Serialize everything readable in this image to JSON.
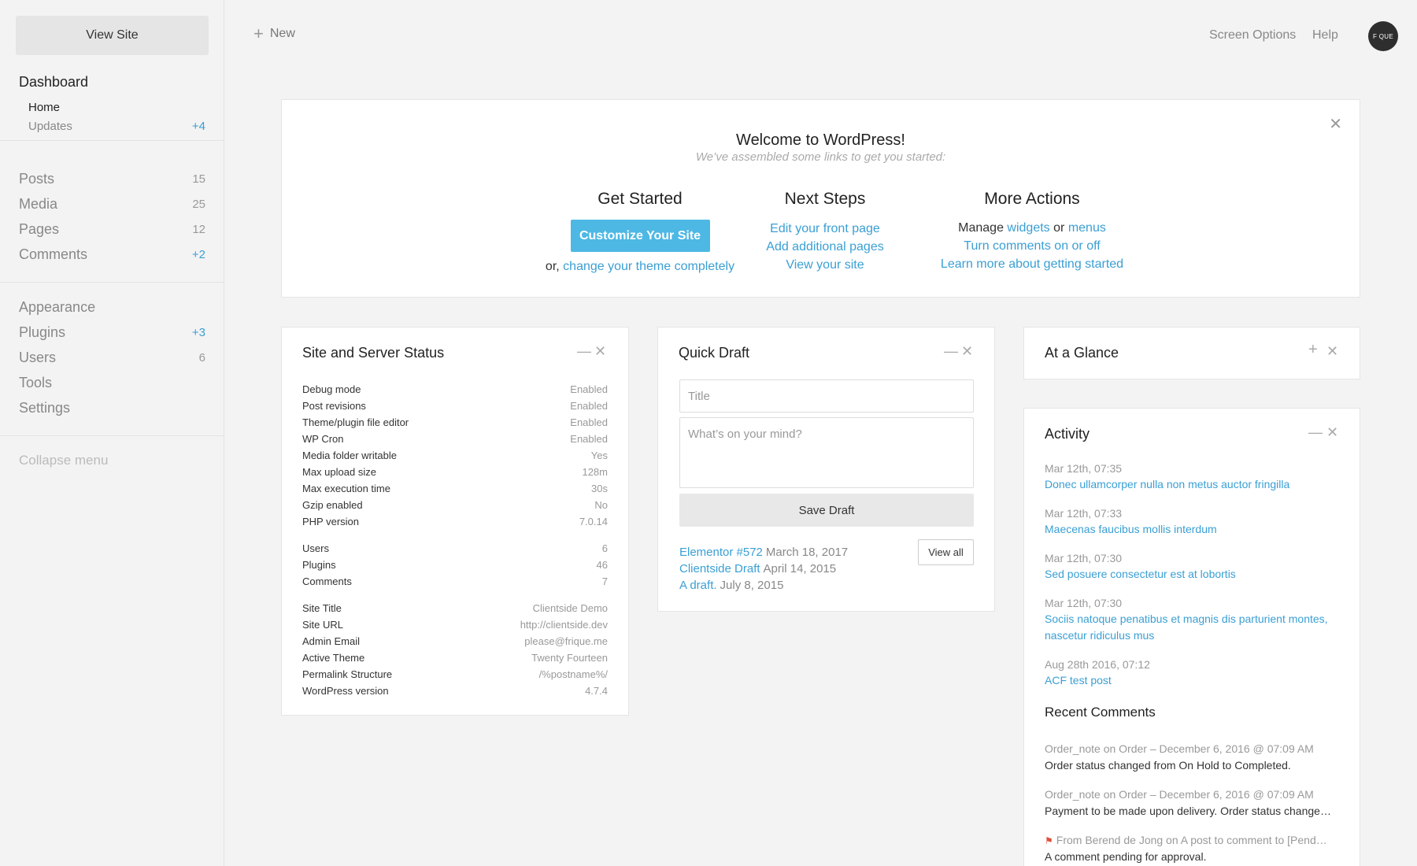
{
  "sidebar": {
    "view_site": "View Site",
    "dashboard": "Dashboard",
    "home": "Home",
    "updates": {
      "label": "Updates",
      "count": "+4"
    },
    "group1": [
      {
        "label": "Posts",
        "count": "15"
      },
      {
        "label": "Media",
        "count": "25"
      },
      {
        "label": "Pages",
        "count": "12"
      },
      {
        "label": "Comments",
        "count": "+2"
      }
    ],
    "group2": [
      {
        "label": "Appearance",
        "count": ""
      },
      {
        "label": "Plugins",
        "count": "+3"
      },
      {
        "label": "Users",
        "count": "6"
      },
      {
        "label": "Tools",
        "count": ""
      },
      {
        "label": "Settings",
        "count": ""
      }
    ],
    "collapse": "Collapse menu"
  },
  "topbar": {
    "new_label": "New",
    "screen_options": "Screen Options",
    "help": "Help",
    "avatar_text": "F QUE"
  },
  "welcome": {
    "title": "Welcome to WordPress!",
    "subtitle": "We’ve assembled some links to get you started:",
    "get_started": {
      "heading": "Get Started",
      "button": "Customize Your Site",
      "or_text": "or,",
      "change_theme": "change your theme completely"
    },
    "next_steps": {
      "heading": "Next Steps",
      "links": [
        "Edit your front page",
        "Add additional pages",
        "View your site"
      ]
    },
    "more_actions": {
      "heading": "More Actions",
      "manage": "Manage",
      "widgets": "widgets",
      "or": "or",
      "menus": "menus",
      "comments": "Turn comments on or off",
      "learn": "Learn more about getting started"
    }
  },
  "status_widget": {
    "title": "Site and Server Status",
    "rows": [
      {
        "label": "Debug mode",
        "value": "Enabled"
      },
      {
        "label": "Post revisions",
        "value": "Enabled"
      },
      {
        "label": "Theme/plugin file editor",
        "value": "Enabled"
      },
      {
        "label": "WP Cron",
        "value": "Enabled"
      },
      {
        "label": "Media folder writable",
        "value": "Yes"
      },
      {
        "label": "Max upload size",
        "value": "128m"
      },
      {
        "label": "Max execution time",
        "value": "30s"
      },
      {
        "label": "Gzip enabled",
        "value": "No"
      },
      {
        "label": "PHP version",
        "value": "7.0.14"
      },
      {
        "label": "Users",
        "value": "6"
      },
      {
        "label": "Plugins",
        "value": "46"
      },
      {
        "label": "Comments",
        "value": "7"
      },
      {
        "label": "Site Title",
        "value": "Clientside Demo"
      },
      {
        "label": "Site URL",
        "value": "http://clientside.dev"
      },
      {
        "label": "Admin Email",
        "value": "please@frique.me"
      },
      {
        "label": "Active Theme",
        "value": "Twenty Fourteen"
      },
      {
        "label": "Permalink Structure",
        "value": "/%postname%/"
      },
      {
        "label": "WordPress version",
        "value": "4.7.4"
      }
    ]
  },
  "draft_widget": {
    "title": "Quick Draft",
    "title_placeholder": "Title",
    "content_placeholder": "What’s on your mind?",
    "save": "Save Draft",
    "view_all": "View all",
    "drafts": [
      {
        "title": "Elementor #572",
        "date": "March 18, 2017"
      },
      {
        "title": "Clientside Draft",
        "date": "April 14, 2015"
      },
      {
        "title": "A draft.",
        "date": "July 8, 2015"
      }
    ]
  },
  "glance_widget": {
    "title": "At a Glance"
  },
  "activity_widget": {
    "title": "Activity",
    "items": [
      {
        "date": "Mar 12th, 07:35",
        "title": "Donec ullamcorper nulla non metus auctor fringilla"
      },
      {
        "date": "Mar 12th, 07:33",
        "title": "Maecenas faucibus mollis interdum"
      },
      {
        "date": "Mar 12th, 07:30",
        "title": "Sed posuere consectetur est at lobortis"
      },
      {
        "date": "Mar 12th, 07:30",
        "title": "Sociis natoque penatibus et magnis dis parturient montes, nascetur ridiculus mus"
      },
      {
        "date": "Aug 28th 2016, 07:12",
        "title": "ACF test post"
      }
    ],
    "recent_comments_title": "Recent Comments",
    "comments": [
      {
        "meta": "Order_note on Order – December 6, 2016 @ 07:09 AM",
        "text": "Order status changed from On Hold to Completed."
      },
      {
        "meta": "Order_note on Order – December 6, 2016 @ 07:09 AM",
        "text": "Payment to be made upon delivery. Order status change…"
      },
      {
        "meta": "From Berend de Jong on A post to comment to [Pend…",
        "text": "A comment pending for approval."
      }
    ]
  },
  "colors": {
    "accent": "#3a9fd4",
    "button": "#4db8e4",
    "flag": "#e0503c"
  }
}
